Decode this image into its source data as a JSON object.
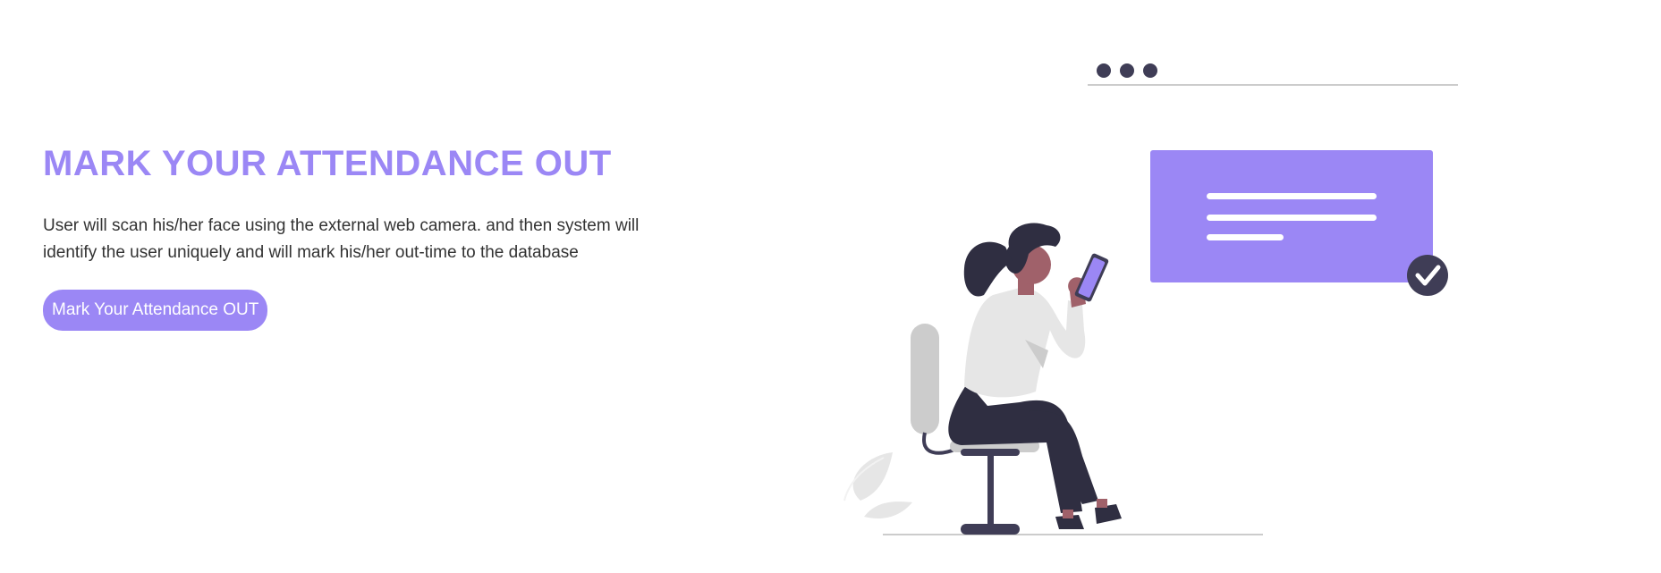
{
  "hero": {
    "title": "MARK YOUR ATTENDANCE OUT",
    "description": "User will scan his/her face using the external web camera. and then system will identify the user uniquely and will mark his/her out-time to the database",
    "button_label": "Mark Your Attendance OUT"
  },
  "colors": {
    "accent": "#9b87f5",
    "dark": "#3f3d56",
    "text": "#333333"
  },
  "illustration": {
    "icons": [
      "window-dots-icon",
      "message-card-icon",
      "check-circle-icon",
      "woman-with-phone-illustration",
      "leaf-icon"
    ]
  }
}
